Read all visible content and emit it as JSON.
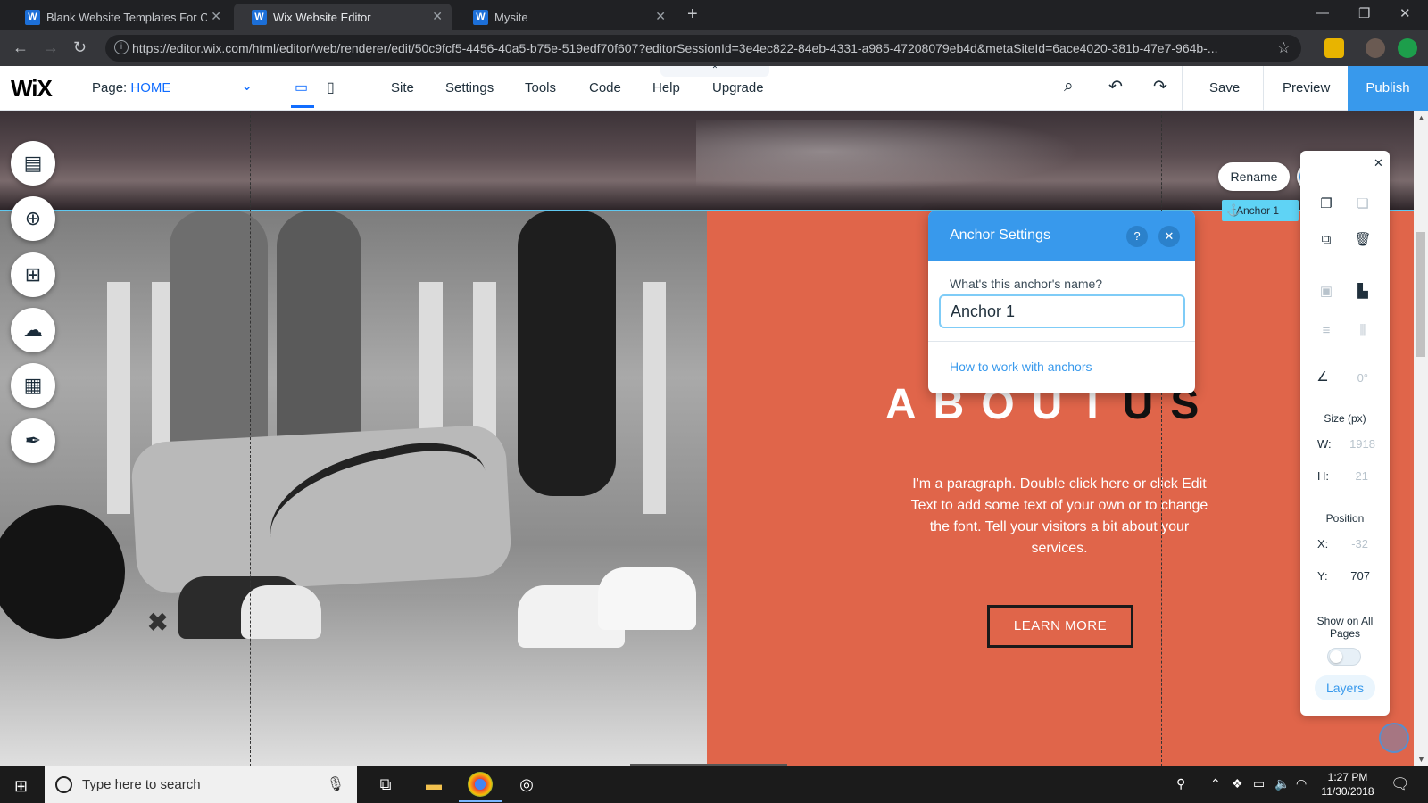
{
  "browser": {
    "tabs": [
      {
        "title": "Blank Website Templates For Cre",
        "favicon": "W"
      },
      {
        "title": "Wix Website Editor",
        "favicon": "W"
      },
      {
        "title": "Mysite",
        "favicon": "W"
      }
    ],
    "active_tab_index": 1,
    "new_tab_icon": "plus-icon",
    "url": "https://editor.wix.com/html/editor/web/renderer/edit/50c9fcf5-4456-40a5-b75e-519edf70f607?editorSessionId=3e4ec822-84eb-4331-a985-47208079eb4d&metaSiteId=6ace4020-381b-47e7-964b-..."
  },
  "editor": {
    "logo": "WiX",
    "page_label": "Page:",
    "page_name": "HOME",
    "menu": [
      "Site",
      "Settings",
      "Tools",
      "Code",
      "Help",
      "Upgrade"
    ],
    "save": "Save",
    "preview": "Preview",
    "publish": "Publish",
    "accent_color": "#3899ec"
  },
  "canvas": {
    "about_title_light": "ABOUT",
    "about_title_dark": "US",
    "about_paragraph": "I'm a paragraph. Double click here or click Edit Text to add some text of your own or to change the font. Tell your visitors a bit about your services.",
    "learn_more": "LEARN MORE",
    "background_color": "#e0654a"
  },
  "anchor_settings": {
    "title": "Anchor Settings",
    "help": "?",
    "name_label": "What's this anchor's name?",
    "name_value": "Anchor 1",
    "link": "How to work with anchors"
  },
  "floating": {
    "rename": "Rename",
    "help": "?",
    "anchor_tag": "Anchor 1"
  },
  "properties": {
    "rotation": "0°",
    "size_label": "Size (px)",
    "w_label": "W:",
    "w_value": "1918",
    "h_label": "H:",
    "h_value": "21",
    "position_label": "Position",
    "x_label": "X:",
    "x_value": "-32",
    "y_label": "Y:",
    "y_value": "707",
    "show_all_pages": "Show on All Pages",
    "show_all_pages_on": false,
    "layers": "Layers"
  },
  "taskbar": {
    "search_placeholder": "Type here to search",
    "time": "1:27 PM",
    "date": "11/30/2018"
  }
}
